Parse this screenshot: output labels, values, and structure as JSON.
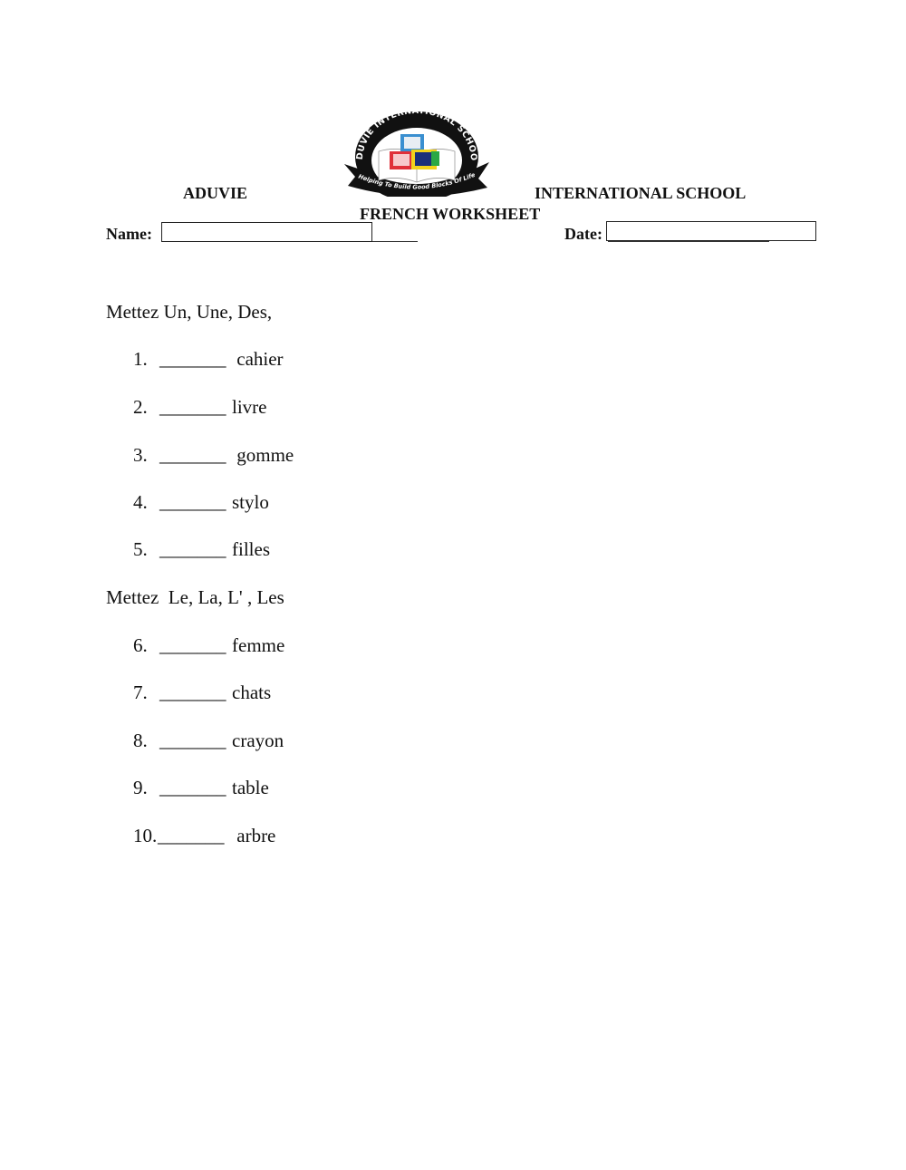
{
  "header": {
    "logo": {
      "ring_text": "ADUVIE INTERNATIONAL SCHOOL",
      "motto": "Helping To Build Good Blocks Of Life",
      "colors": {
        "ring": "#111111",
        "block_blue": "#3a8fd0",
        "block_red": "#e0303a",
        "block_yellow": "#f2d21c",
        "block_navy": "#1b2f7a",
        "block_green": "#2aa845"
      }
    },
    "school_left": "ADUVIE",
    "school_right": "INTERNATIONAL SCHOOL",
    "worksheet_title": "FRENCH WORKSHEET",
    "name_label": "Name:",
    "name_value": "",
    "date_label": "Date:",
    "date_value": ""
  },
  "sections": [
    {
      "instruction": "Mettez Un, Une, Des,",
      "questions": [
        {
          "number": "1.",
          "blank": "_______",
          "word": " cahier"
        },
        {
          "number": "2.",
          "blank": "_______",
          "word": "livre"
        },
        {
          "number": "3.",
          "blank": "_______",
          "word": " gomme"
        },
        {
          "number": "4.",
          "blank": "_______",
          "word": "stylo"
        },
        {
          "number": "5.",
          "blank": "_______",
          "word": "filles"
        }
      ]
    },
    {
      "instruction": "Mettez  Le, La, L' , Les",
      "questions": [
        {
          "number": "6.",
          "blank": "_______",
          "word": "femme"
        },
        {
          "number": "7.",
          "blank": "_______",
          "word": "chats"
        },
        {
          "number": "8.",
          "blank": "_______",
          "word": "crayon"
        },
        {
          "number": "9.",
          "blank": "_______",
          "word": "table"
        },
        {
          "number": "10.",
          "blank": "_______",
          "word": " arbre"
        }
      ]
    }
  ]
}
